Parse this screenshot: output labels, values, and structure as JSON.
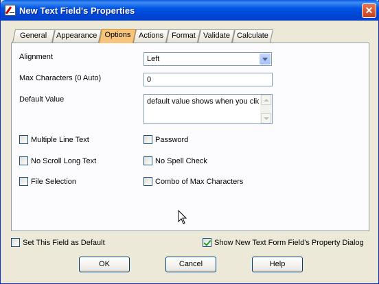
{
  "window": {
    "title": "New Text Field's Properties",
    "close_glyph": "✕"
  },
  "tabs": [
    {
      "label": "General"
    },
    {
      "label": "Appearance"
    },
    {
      "label": "Options"
    },
    {
      "label": "Actions"
    },
    {
      "label": "Format"
    },
    {
      "label": "Validate"
    },
    {
      "label": "Calculate"
    }
  ],
  "active_tab": "Options",
  "options": {
    "alignment_label": "Alignment",
    "alignment_value": "Left",
    "max_chars_label": "Max Characters (0 Auto)",
    "max_chars_value": "0",
    "default_value_label": "Default Value",
    "default_value_text": "default value shows when you click"
  },
  "checkboxes": [
    {
      "label": "Multiple Line Text",
      "checked": false
    },
    {
      "label": "Password",
      "checked": false
    },
    {
      "label": "No Scroll Long Text",
      "checked": false
    },
    {
      "label": "No Spell Check",
      "checked": false
    },
    {
      "label": "File Selection",
      "checked": false
    },
    {
      "label": "Combo of Max Characters",
      "checked": false
    }
  ],
  "footer": {
    "set_default_label": "Set This Field as Default",
    "set_default_checked": false,
    "show_dialog_label": "Show New Text Form Field's Property Dialog",
    "show_dialog_checked": true
  },
  "buttons": {
    "ok": "OK",
    "cancel": "Cancel",
    "help": "Help"
  },
  "icons": {
    "title": "document-edit-icon",
    "cursor": "mouse-pointer-icon"
  },
  "colors": {
    "titlebar": "#0055e5",
    "active_tab": "#f7c47c",
    "dialog_bg": "#ece9d8"
  }
}
